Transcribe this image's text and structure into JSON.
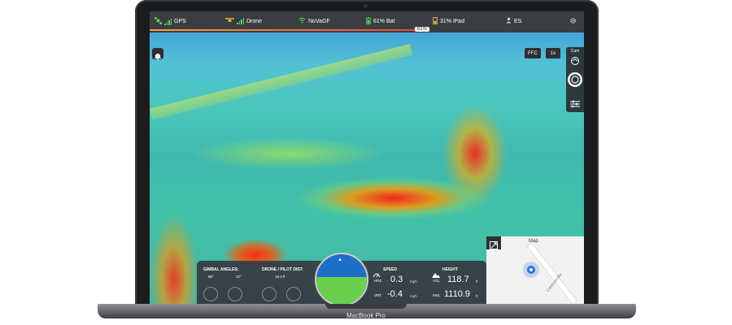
{
  "device": {
    "brand": "MacBook Pro"
  },
  "statusbar": {
    "gps_label": "GPS",
    "drone_label": "Drone",
    "wifi_label": "NoVaGF",
    "battery_label": "61% Bat",
    "ipad_label": "31% iPad",
    "user_label": "ES",
    "battery_tag": "61%",
    "battery_percent": 61
  },
  "controls": {
    "ffc_label": "FFC",
    "zoom_label": "1x",
    "cam_label": "Cam"
  },
  "telemetry": {
    "gimbal_title": "GIMBAL ANGLES:",
    "gimbal_pitch": "85°",
    "gimbal_yaw": "12°",
    "distance_title": "DRONE / PILOT DIST:",
    "distance_value": "18.2 ft",
    "speed_title": "SPEED",
    "hrz_label": "HRZ",
    "hrz_value": "0.3",
    "vrt_label": "VRT",
    "vrt_value": "-0.4",
    "speed_unit": "mph",
    "height_title": "HEIGHT",
    "agl_label": "AGL",
    "agl_value": "118.7",
    "msl_label": "MSL",
    "msl_value": "1110.9",
    "height_unit": "ft"
  },
  "map": {
    "label": "Map",
    "street_label": "Cabbotsville"
  },
  "icons": {
    "satellite": "satellite-icon",
    "drone": "drone-icon",
    "wifi": "wifi-icon",
    "battery": "battery-icon",
    "ipad_battery": "ipad-battery-icon",
    "user": "user-icon",
    "settings": "gear-icon",
    "bell": "bell-icon",
    "camera_switch": "camera-switch-icon",
    "shutter": "shutter-icon",
    "sliders": "sliders-icon",
    "expand": "expand-icon",
    "compass": "compass-icon"
  },
  "colors": {
    "accent_green": "#57d35b",
    "panel": "#3a3d42"
  }
}
